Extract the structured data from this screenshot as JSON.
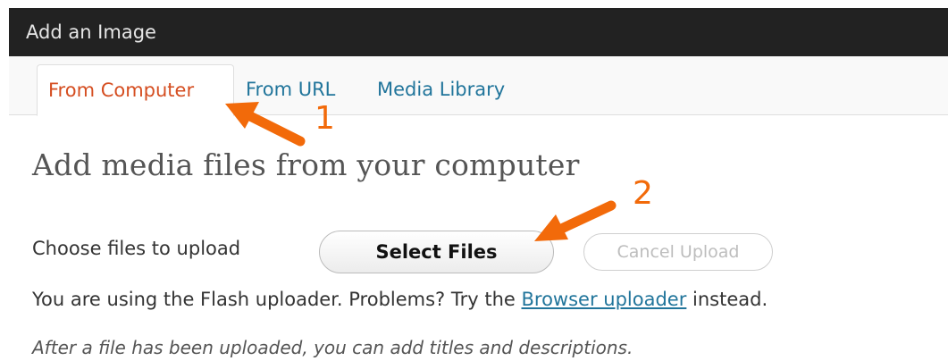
{
  "window": {
    "title": "Add an Image"
  },
  "tabs": [
    {
      "label": "From Computer",
      "active": true
    },
    {
      "label": "From URL",
      "active": false
    },
    {
      "label": "Media Library",
      "active": false
    }
  ],
  "main": {
    "heading": "Add media files from your computer",
    "choose_label": "Choose files to upload",
    "select_button": "Select Files",
    "cancel_button": "Cancel Upload",
    "flash_text_before": "You are using the Flash uploader. Problems? Try the ",
    "flash_link": "Browser uploader",
    "flash_text_after": " instead.",
    "after_upload_note": "After a file has been uploaded, you can add titles and descriptions."
  },
  "annotations": {
    "step1": "1",
    "step2": "2",
    "arrow_color": "#f26a0a"
  },
  "colors": {
    "titlebar_bg": "#222222",
    "active_tab": "#d54e21",
    "link": "#21759b"
  }
}
